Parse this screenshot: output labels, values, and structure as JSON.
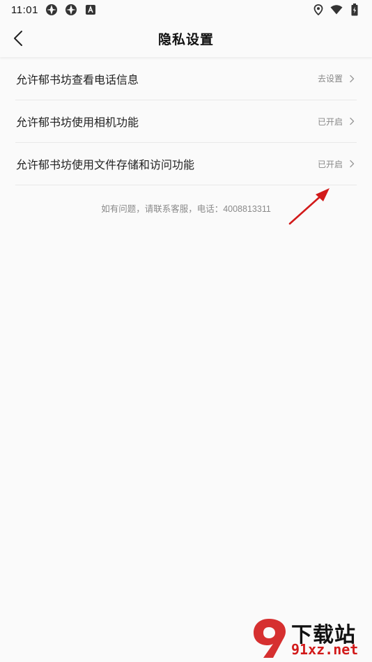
{
  "status_bar": {
    "time": "11:01",
    "icons_left": [
      "app-icon",
      "app-icon",
      "notification-icon"
    ],
    "icons_right": [
      "location-icon",
      "wifi-icon",
      "battery-icon"
    ]
  },
  "header": {
    "title": "隐私设置",
    "back_icon": "chevron-left-icon"
  },
  "settings": {
    "items": [
      {
        "label": "允许郁书坊查看电话信息",
        "status": "去设置"
      },
      {
        "label": "允许郁书坊使用相机功能",
        "status": "已开启"
      },
      {
        "label": "允许郁书坊使用文件存储和访问功能",
        "status": "已开启"
      }
    ]
  },
  "footer": {
    "contact_note": "如有问题，请联系客服，电话：4008813311"
  },
  "watermark": {
    "top_text": "下载站",
    "bottom_text": "91xz.net"
  },
  "colors": {
    "background": "#fafafa",
    "accent_red": "#d21a1a",
    "divider": "#e8e8e8",
    "secondary_text": "#888888"
  }
}
